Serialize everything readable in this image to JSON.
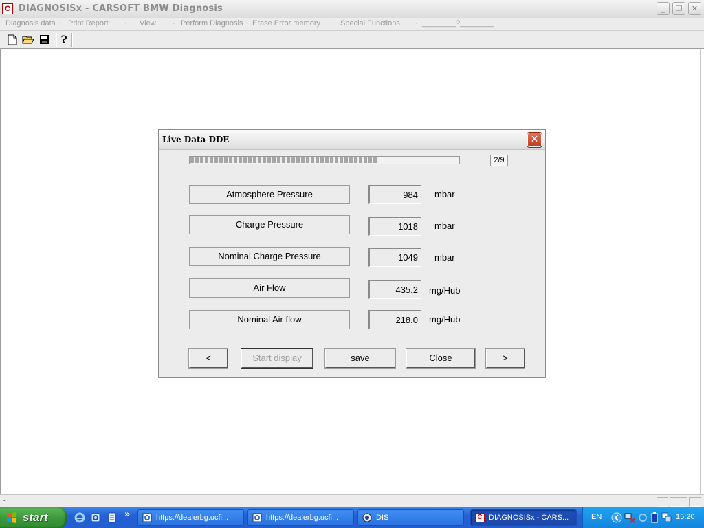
{
  "window": {
    "app_icon_letter": "C",
    "title": "DIAGNOSISx - CARSOFT BMW Diagnosis",
    "minimize": "_",
    "restore": "❐",
    "close": "✕"
  },
  "menu": {
    "items": [
      "Diagnosis data",
      "Print Report",
      "View",
      "Perform Diagnosis",
      "Erase Error memory",
      "Special Functions",
      "________?________"
    ],
    "separators": [
      "·",
      "·",
      "·",
      "·",
      "·",
      "·"
    ]
  },
  "toolbar": {
    "icons": [
      "new-document-icon",
      "open-folder-icon",
      "save-disk-icon",
      "help-icon"
    ],
    "help_glyph": "?"
  },
  "dialog": {
    "title": "Live Data DDE",
    "close_glyph": "✕",
    "progress": 0.7,
    "page_indicator": "2/9",
    "rows": [
      {
        "label": "Atmosphere Pressure",
        "value": "984",
        "unit": "mbar"
      },
      {
        "label": "Charge Pressure",
        "value": "1018",
        "unit": "mbar"
      },
      {
        "label": "Nominal Charge Pressure",
        "value": "1049",
        "unit": "mbar"
      },
      {
        "label": "Air Flow",
        "value": "435.2",
        "unit": "mg/Hub"
      },
      {
        "label": "Nominal Air flow",
        "value": "218.0",
        "unit": "mg/Hub"
      }
    ],
    "buttons": {
      "prev": "<",
      "start_display": "Start display",
      "save": "save",
      "close": "Close",
      "next": ">"
    }
  },
  "statusbar": {
    "text": "-"
  },
  "taskbar": {
    "start_label": "start",
    "chevron": "»",
    "tasks": [
      {
        "label": "https://dealerbg.ucfi...",
        "icon": "ie-page-icon"
      },
      {
        "label": "https://dealerbg.ucfi...",
        "icon": "ie-page-icon"
      },
      {
        "label": "DIS",
        "icon": "dis-globe-icon"
      },
      {
        "label": "DIAGNOSISx - CARS...",
        "icon": "carsoft-icon"
      }
    ],
    "tray": {
      "language": "EN",
      "time": "15:20"
    }
  }
}
